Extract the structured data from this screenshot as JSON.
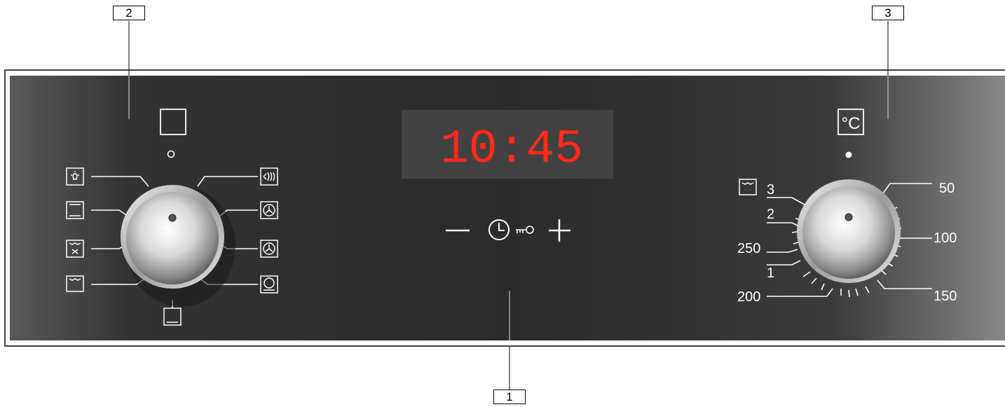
{
  "callouts": {
    "display": "1",
    "function_selector": "2",
    "temperature_selector": "3"
  },
  "display": {
    "time": "10:45",
    "color": "#ff2a1a"
  },
  "controls": {
    "minus": "−",
    "plus": "+"
  },
  "temperature": {
    "unit_symbol": "°C",
    "labels": {
      "grill_3": "3",
      "grill_2": "2",
      "t250": "250",
      "grill_1": "1",
      "t200": "200",
      "t50": "50",
      "t100": "100",
      "t150": "150"
    }
  },
  "function_knob": {
    "left_icons": [
      "oven-light-icon",
      "top-bottom-heat-icon",
      "grill-fan-icon",
      "grill-icon"
    ],
    "right_icons": [
      "defrost-icon",
      "fan-heat-icon",
      "pizza-setting-icon",
      "bottom-fan-icon"
    ],
    "bottom_icon": "bottom-heat-icon",
    "top_icon": "off-position-icon"
  },
  "colors": {
    "panel": "#2d2d2d",
    "display_bg": "#3f3f3f",
    "display_digits": "#ff2a1a"
  }
}
